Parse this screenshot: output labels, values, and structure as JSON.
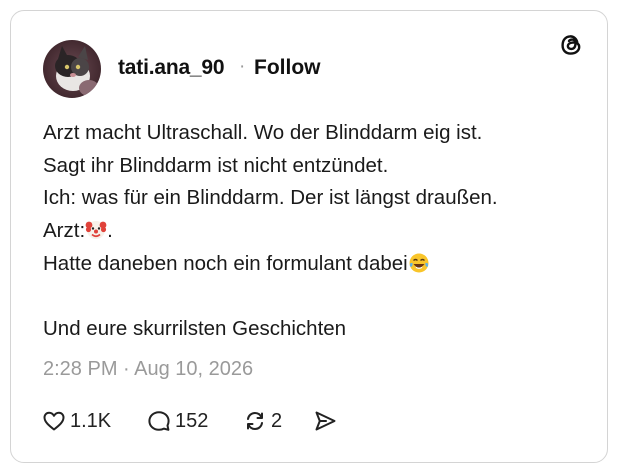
{
  "author": {
    "username": "tati.ana_90",
    "separator": "·",
    "follow_label": "Follow"
  },
  "post": {
    "lines": [
      "Arzt macht Ultraschall. Wo der Blinddarm eig ist.",
      "Sagt ihr Blinddarm ist nicht entzündet.",
      "Ich: was für ein Blinddarm. Der ist längst draußen.",
      "Arzt:",
      "Hatte daneben noch ein formulant dabei",
      "",
      "Und eure skurrilsten Geschichten"
    ],
    "line4_suffix": ".",
    "emojis": [
      "clown-face",
      "tears-of-joy"
    ]
  },
  "timestamp": "2:28 PM · Aug 10, 2026",
  "actions": {
    "likes": "1.1K",
    "replies": "152",
    "reposts": "2"
  },
  "icons": [
    "threads-logo-icon",
    "heart-icon",
    "comment-icon",
    "repost-icon",
    "share-icon"
  ],
  "colors": {
    "text": "#1a1a1a",
    "muted": "#9a9a9a",
    "border": "#d4d4d4"
  }
}
